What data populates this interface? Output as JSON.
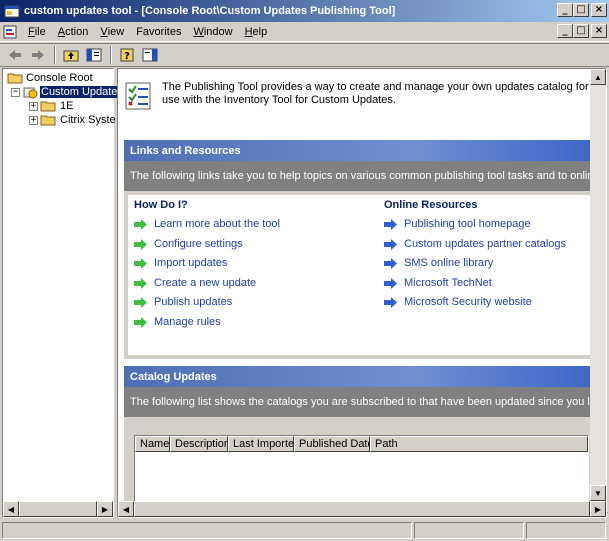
{
  "window": {
    "title": "custom updates tool - [Console Root\\Custom Updates Publishing Tool]",
    "minimize": "_",
    "restore": "□",
    "close": "×"
  },
  "menu": {
    "items": [
      {
        "label": "File",
        "accel": "F",
        "rest": "ile"
      },
      {
        "label": "Action",
        "accel": "A",
        "rest": "ction"
      },
      {
        "label": "View",
        "accel": "V",
        "rest": "iew"
      },
      {
        "label": "Favorites",
        "accel": "",
        "rest": "Favorites"
      },
      {
        "label": "Window",
        "accel": "W",
        "rest": "indow"
      },
      {
        "label": "Help",
        "accel": "H",
        "rest": "elp"
      }
    ]
  },
  "tree": {
    "root": "Console Root",
    "child": "Custom Update",
    "grandchildren": [
      "1E",
      "Citrix Syste"
    ]
  },
  "intro": {
    "text": "The Publishing Tool provides a way to create and manage your own updates catalog for use with the Inventory Tool for Custom Updates."
  },
  "links": {
    "header": "Links and Resources",
    "description": "The following links take you to help topics on various common publishing tool tasks and to online resources.",
    "how_title": "How Do I?",
    "how_items": [
      "Learn more about the tool",
      "Configure settings",
      "Import updates",
      "Create a new update",
      "Publish updates",
      "Manage rules"
    ],
    "online_title": "Online Resources",
    "online_items": [
      "Publishing tool homepage",
      "Custom updates partner catalogs",
      "SMS online library",
      "Microsoft TechNet",
      "Microsoft Security website"
    ]
  },
  "catalog": {
    "header": "Catalog Updates",
    "description": "The following list shows the catalogs you are subscribed to that have been updated since you last imported th",
    "columns": [
      "Name",
      "Description",
      "Last Imported",
      "Published Date",
      "Path"
    ]
  },
  "colors": {
    "title_start": "#0a246a",
    "title_end": "#a6caf0",
    "link": "#1f3fa8",
    "green_arrow": "#3fbf3f",
    "blue_arrow": "#2f5fd0"
  }
}
